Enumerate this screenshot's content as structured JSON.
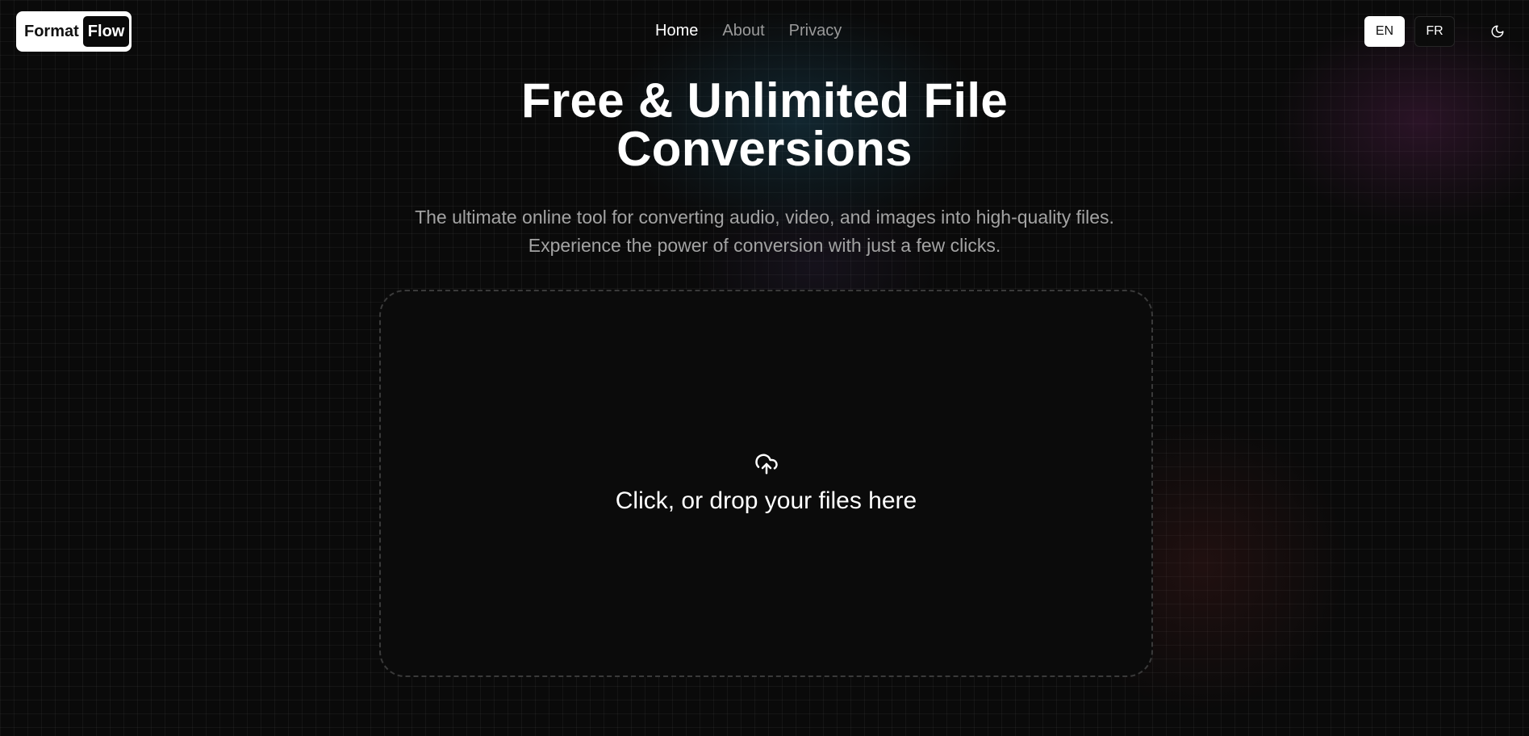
{
  "header": {
    "logo": {
      "part1": "Format",
      "part2": "Flow"
    },
    "nav": [
      {
        "label": "Home",
        "active": true
      },
      {
        "label": "About",
        "active": false
      },
      {
        "label": "Privacy",
        "active": false
      }
    ],
    "languages": [
      {
        "label": "EN",
        "selected": true
      },
      {
        "label": "FR",
        "selected": false
      }
    ],
    "theme_toggle_icon": "moon-icon"
  },
  "hero": {
    "title_line1": "Free & Unlimited File",
    "title_line2": "Conversions",
    "subtitle_line1": "The ultimate online tool for converting audio, video, and images into high-quality files.",
    "subtitle_line2": "Experience the power of conversion with just a few clicks."
  },
  "dropzone": {
    "icon": "cloud-upload-icon",
    "label": "Click, or drop your files here"
  },
  "colors": {
    "background": "#0a0a0a",
    "text_primary": "#ffffff",
    "text_muted": "#a3a3a3",
    "dropzone_border": "#3a3a3a"
  }
}
